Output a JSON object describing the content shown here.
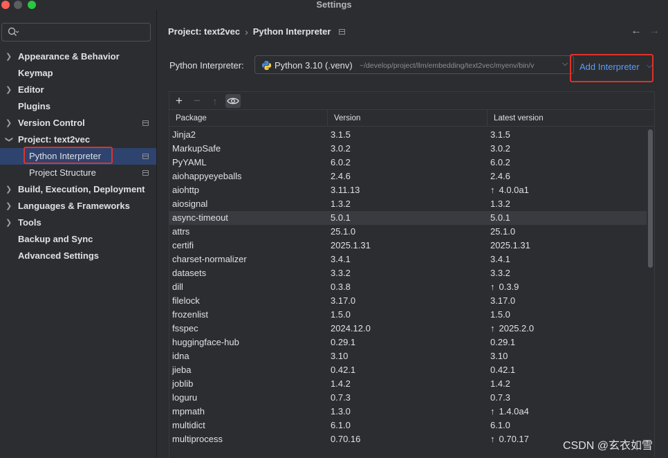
{
  "window": {
    "title": "Settings"
  },
  "search": {
    "placeholder": "",
    "value": ""
  },
  "sidebar": {
    "items": [
      {
        "label": "Appearance & Behavior"
      },
      {
        "label": "Keymap"
      },
      {
        "label": "Editor"
      },
      {
        "label": "Plugins"
      },
      {
        "label": "Version Control"
      },
      {
        "label": "Project: text2vec"
      },
      {
        "label": "Python Interpreter"
      },
      {
        "label": "Project Structure"
      },
      {
        "label": "Build, Execution, Deployment"
      },
      {
        "label": "Languages & Frameworks"
      },
      {
        "label": "Tools"
      },
      {
        "label": "Backup and Sync"
      },
      {
        "label": "Advanced Settings"
      }
    ]
  },
  "breadcrumb": {
    "project": "Project: text2vec",
    "page": "Python Interpreter"
  },
  "interpreter": {
    "label": "Python Interpreter:",
    "name": "Python 3.10 (.venv)",
    "path": "~/develop/project/llm/embedding/text2vec/myenv/bin/v",
    "add_label": "Add Interpreter"
  },
  "table": {
    "headers": {
      "package": "Package",
      "version": "Version",
      "latest": "Latest version"
    },
    "rows": [
      {
        "package": "Jinja2",
        "version": "3.1.5",
        "latest": "3.1.5",
        "upgrade": false
      },
      {
        "package": "MarkupSafe",
        "version": "3.0.2",
        "latest": "3.0.2",
        "upgrade": false
      },
      {
        "package": "PyYAML",
        "version": "6.0.2",
        "latest": "6.0.2",
        "upgrade": false
      },
      {
        "package": "aiohappyeyeballs",
        "version": "2.4.6",
        "latest": "2.4.6",
        "upgrade": false
      },
      {
        "package": "aiohttp",
        "version": "3.11.13",
        "latest": "4.0.0a1",
        "upgrade": true
      },
      {
        "package": "aiosignal",
        "version": "1.3.2",
        "latest": "1.3.2",
        "upgrade": false
      },
      {
        "package": "async-timeout",
        "version": "5.0.1",
        "latest": "5.0.1",
        "upgrade": false
      },
      {
        "package": "attrs",
        "version": "25.1.0",
        "latest": "25.1.0",
        "upgrade": false
      },
      {
        "package": "certifi",
        "version": "2025.1.31",
        "latest": "2025.1.31",
        "upgrade": false
      },
      {
        "package": "charset-normalizer",
        "version": "3.4.1",
        "latest": "3.4.1",
        "upgrade": false
      },
      {
        "package": "datasets",
        "version": "3.3.2",
        "latest": "3.3.2",
        "upgrade": false
      },
      {
        "package": "dill",
        "version": "0.3.8",
        "latest": "0.3.9",
        "upgrade": true
      },
      {
        "package": "filelock",
        "version": "3.17.0",
        "latest": "3.17.0",
        "upgrade": false
      },
      {
        "package": "frozenlist",
        "version": "1.5.0",
        "latest": "1.5.0",
        "upgrade": false
      },
      {
        "package": "fsspec",
        "version": "2024.12.0",
        "latest": "2025.2.0",
        "upgrade": true
      },
      {
        "package": "huggingface-hub",
        "version": "0.29.1",
        "latest": "0.29.1",
        "upgrade": false
      },
      {
        "package": "idna",
        "version": "3.10",
        "latest": "3.10",
        "upgrade": false
      },
      {
        "package": "jieba",
        "version": "0.42.1",
        "latest": "0.42.1",
        "upgrade": false
      },
      {
        "package": "joblib",
        "version": "1.4.2",
        "latest": "1.4.2",
        "upgrade": false
      },
      {
        "package": "loguru",
        "version": "0.7.3",
        "latest": "0.7.3",
        "upgrade": false
      },
      {
        "package": "mpmath",
        "version": "1.3.0",
        "latest": "1.4.0a4",
        "upgrade": true
      },
      {
        "package": "multidict",
        "version": "6.1.0",
        "latest": "6.1.0",
        "upgrade": false
      },
      {
        "package": "multiprocess",
        "version": "0.70.16",
        "latest": "0.70.17",
        "upgrade": true
      }
    ]
  },
  "watermark": "CSDN @玄衣如雪",
  "icons": {
    "search": "search-icon",
    "add": "plus-icon",
    "remove": "minus-icon",
    "upgrade": "arrow-up-icon",
    "show_early": "eye-icon",
    "back": "arrow-left-icon",
    "forward": "arrow-right-icon"
  },
  "colors": {
    "selection": "#2e436e",
    "link": "#5f9bf7",
    "highlight_border": "#e0322a"
  }
}
